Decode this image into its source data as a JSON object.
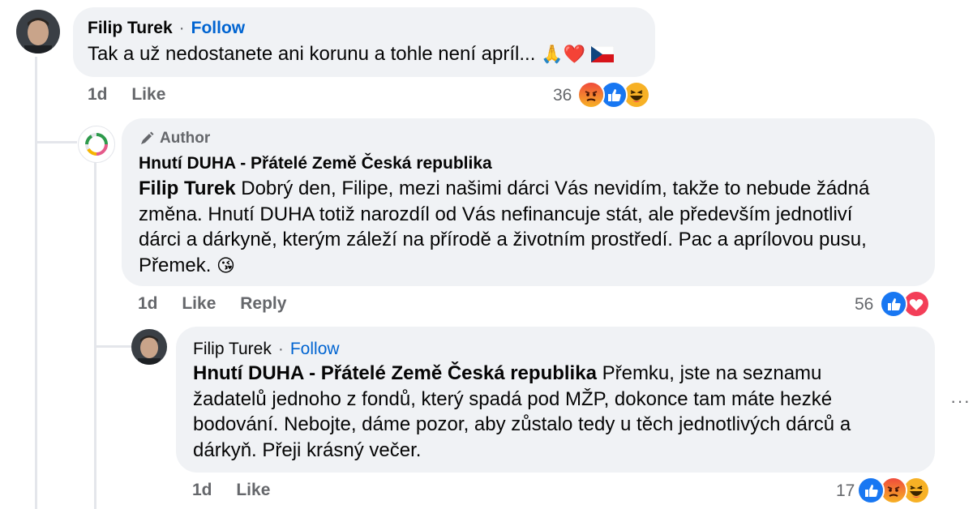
{
  "comments": [
    {
      "author": "Filip Turek",
      "follow_label": "Follow",
      "separator": "·",
      "text": "Tak a už nedostanete ani korunu a tohle není apríl...",
      "emojis": "🙏❤️",
      "time": "1d",
      "like_label": "Like",
      "reaction_count": "36"
    },
    {
      "author_badge": "Author",
      "author": "Hnutí DUHA - Přátelé Země Česká republika",
      "mention": "Filip Turek",
      "text_line1": "Dobrý den, Filipe, mezi našimi dárci Vás nevidím, takže to nebude žádná",
      "text_line2": "změna. Hnutí DUHA totiž narozdíl od Vás nefinancuje stát, ale především jednotliví",
      "text_line3": "dárci a dárkyně, kterým záleží na přírodě a životním prostředí. Pac a aprílovou pusu,",
      "text_line4": "Přemek.",
      "emoji": "😘",
      "time": "1d",
      "like_label": "Like",
      "reply_label": "Reply",
      "reaction_count": "56"
    },
    {
      "author": "Filip Turek",
      "follow_label": "Follow",
      "separator": "·",
      "mention": "Hnutí DUHA - Přátelé Země Česká republika",
      "text_line1": "Přemku, jste na seznamu",
      "text_line2": "žadatelů jednoho z fondů, který spadá pod MŽP, dokonce tam máte hezké",
      "text_line3": "bodování. Nebojte, dáme pozor, aby zůstalo tedy u těch jednotlivých dárců a",
      "text_line4": "dárkyň. Přeji krásný večer.",
      "time": "1d",
      "like_label": "Like",
      "reaction_count": "17"
    }
  ],
  "more_options": "···",
  "colors": {
    "bubble": "#f0f2f5",
    "follow": "#0064d1",
    "meta": "#65676b",
    "like_blue": "#1877f2",
    "love_red": "#f33e58",
    "angry_orange": "#e9710f",
    "haha_yellow": "#f7b125"
  }
}
